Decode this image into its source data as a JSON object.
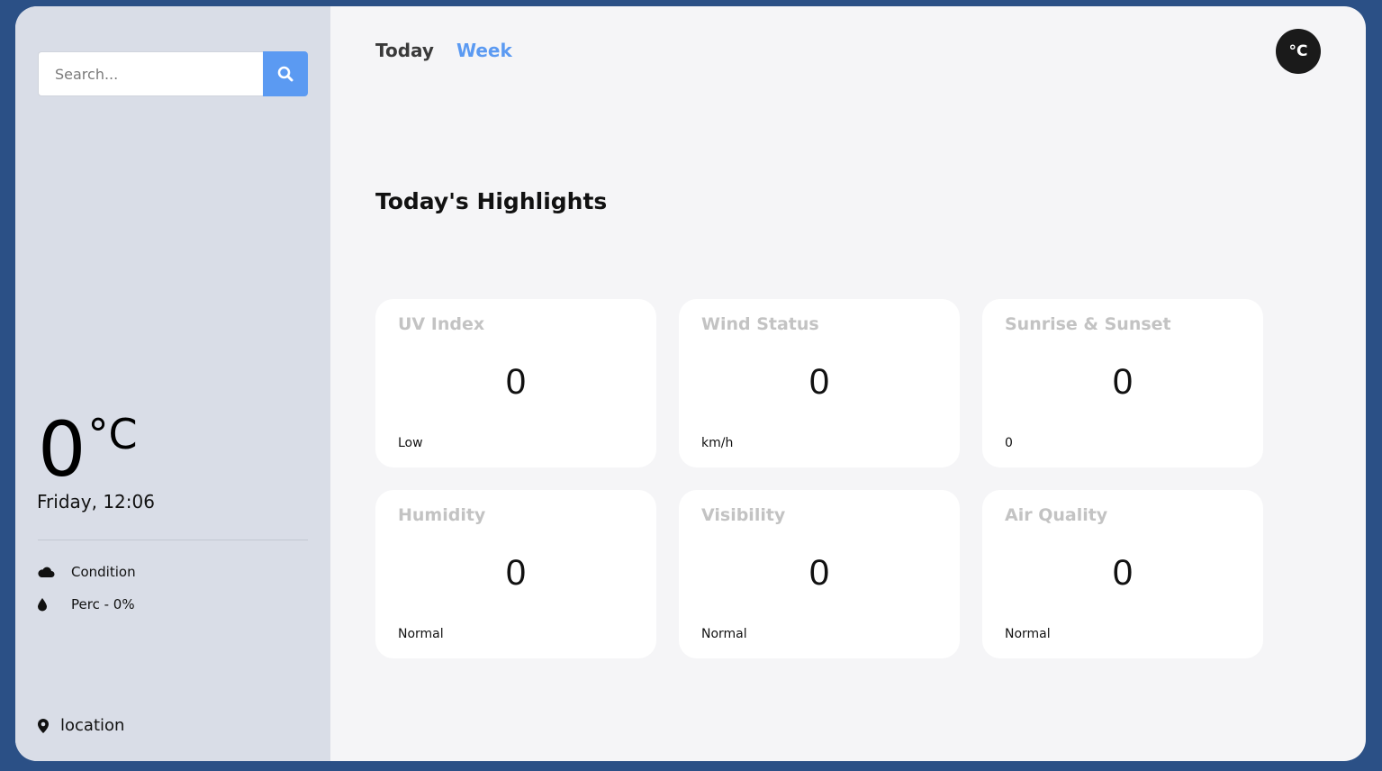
{
  "search": {
    "placeholder": "Search..."
  },
  "current": {
    "temperature": "0",
    "unit": "°C",
    "datetime": "Friday, 12:06",
    "condition": "Condition",
    "precipitation": "Perc - 0%",
    "location": "location"
  },
  "tabs": [
    {
      "label": "Today"
    },
    {
      "label": "Week"
    }
  ],
  "unit_toggle": "°C",
  "highlights": {
    "title": "Today's Highlights",
    "cards": [
      {
        "title": "UV Index",
        "value": "0",
        "foot": "Low"
      },
      {
        "title": "Wind Status",
        "value": "0",
        "foot": "km/h"
      },
      {
        "title": "Sunrise & Sunset",
        "value": "0",
        "foot": "0"
      },
      {
        "title": "Humidity",
        "value": "0",
        "foot": "Normal"
      },
      {
        "title": "Visibility",
        "value": "0",
        "foot": "Normal"
      },
      {
        "title": "Air Quality",
        "value": "0",
        "foot": "Normal"
      }
    ]
  },
  "colors": {
    "accent": "#5b9af2",
    "frame": "#2b5086",
    "sidebar": "#d9dde7",
    "main": "#f5f5f7",
    "card_title": "#c3c3c3"
  },
  "icons": {
    "search": "search-icon",
    "condition": "cloud-icon",
    "precipitation": "droplet-icon",
    "location": "map-pin-icon"
  }
}
